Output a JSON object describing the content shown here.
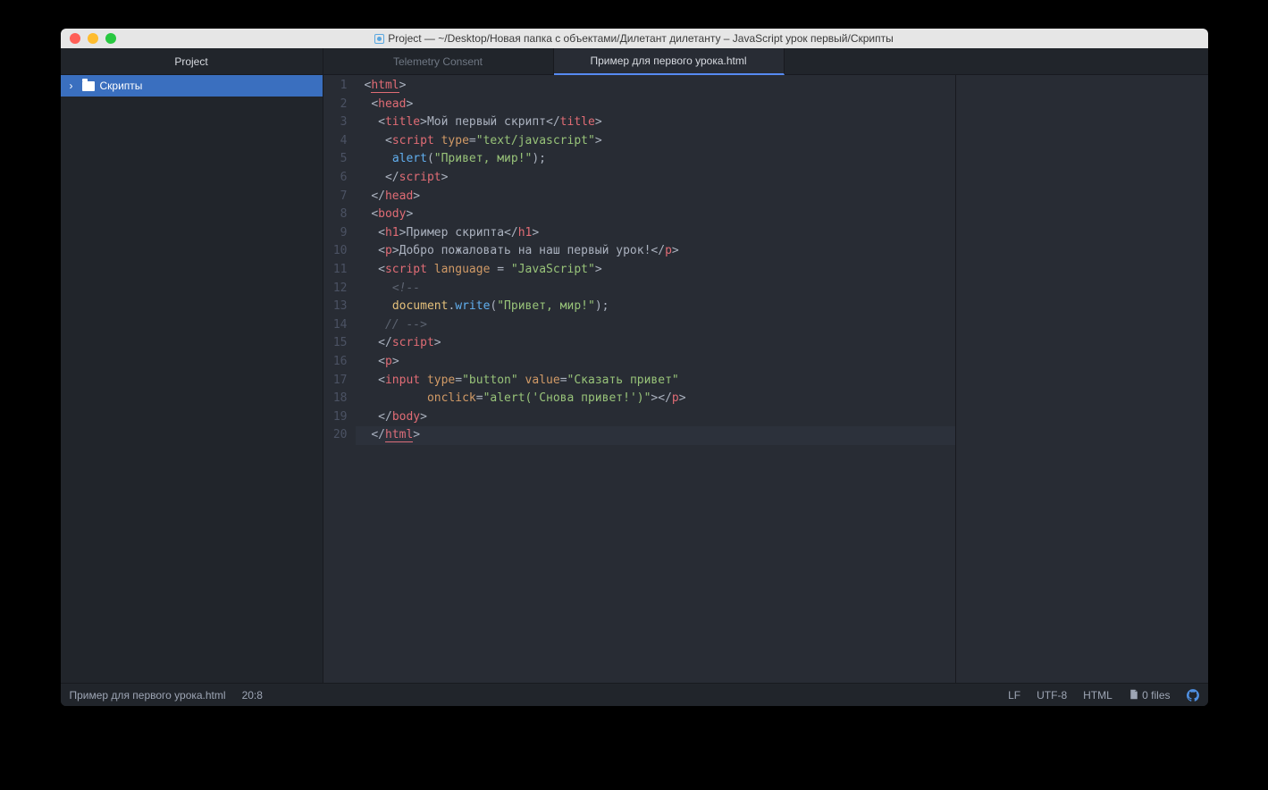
{
  "window": {
    "title": "Project — ~/Desktop/Новая папка с объектами/Дилетант дилетанту – JavaScript урок первый/Скрипты"
  },
  "panes": {
    "project_label": "Project"
  },
  "tabs": [
    {
      "label": "Telemetry Consent",
      "active": false
    },
    {
      "label": "Пример для первого урока.html",
      "active": true
    }
  ],
  "tree": {
    "items": [
      {
        "label": "Скрипты",
        "expanded": true
      }
    ]
  },
  "editor": {
    "cursor_line": 20,
    "line_count": 20,
    "lines": [
      [
        {
          "t": "<",
          "c": "punc"
        },
        {
          "t": "html",
          "c": "tag",
          "u": true
        },
        {
          "t": ">",
          "c": "punc"
        }
      ],
      [
        {
          "t": " ",
          "c": "text"
        },
        {
          "t": "<",
          "c": "punc"
        },
        {
          "t": "head",
          "c": "tag"
        },
        {
          "t": ">",
          "c": "punc"
        }
      ],
      [
        {
          "t": "  ",
          "c": "text"
        },
        {
          "t": "<",
          "c": "punc"
        },
        {
          "t": "title",
          "c": "tag"
        },
        {
          "t": ">",
          "c": "punc"
        },
        {
          "t": "Мой первый скрипт",
          "c": "text"
        },
        {
          "t": "</",
          "c": "punc"
        },
        {
          "t": "title",
          "c": "tag"
        },
        {
          "t": ">",
          "c": "punc"
        }
      ],
      [
        {
          "t": "   ",
          "c": "text"
        },
        {
          "t": "<",
          "c": "punc"
        },
        {
          "t": "script",
          "c": "tag"
        },
        {
          "t": " ",
          "c": "text"
        },
        {
          "t": "type",
          "c": "attr"
        },
        {
          "t": "=",
          "c": "punc"
        },
        {
          "t": "\"text/javascript\"",
          "c": "str"
        },
        {
          "t": ">",
          "c": "punc"
        }
      ],
      [
        {
          "t": "    ",
          "c": "text"
        },
        {
          "t": "alert",
          "c": "fn"
        },
        {
          "t": "(",
          "c": "punc"
        },
        {
          "t": "\"Привет, мир!\"",
          "c": "str"
        },
        {
          "t": ");",
          "c": "punc"
        }
      ],
      [
        {
          "t": "   ",
          "c": "text"
        },
        {
          "t": "</",
          "c": "punc"
        },
        {
          "t": "script",
          "c": "tag"
        },
        {
          "t": ">",
          "c": "punc"
        }
      ],
      [
        {
          "t": " ",
          "c": "text"
        },
        {
          "t": "</",
          "c": "punc"
        },
        {
          "t": "head",
          "c": "tag"
        },
        {
          "t": ">",
          "c": "punc"
        }
      ],
      [
        {
          "t": " ",
          "c": "text"
        },
        {
          "t": "<",
          "c": "punc"
        },
        {
          "t": "body",
          "c": "tag"
        },
        {
          "t": ">",
          "c": "punc"
        }
      ],
      [
        {
          "t": "  ",
          "c": "text"
        },
        {
          "t": "<",
          "c": "punc"
        },
        {
          "t": "h1",
          "c": "tag"
        },
        {
          "t": ">",
          "c": "punc"
        },
        {
          "t": "Пример скрипта",
          "c": "text"
        },
        {
          "t": "</",
          "c": "punc"
        },
        {
          "t": "h1",
          "c": "tag"
        },
        {
          "t": ">",
          "c": "punc"
        }
      ],
      [
        {
          "t": "  ",
          "c": "text"
        },
        {
          "t": "<",
          "c": "punc"
        },
        {
          "t": "p",
          "c": "tag"
        },
        {
          "t": ">",
          "c": "punc"
        },
        {
          "t": "Добро пожаловать на наш первый урок!",
          "c": "text"
        },
        {
          "t": "</",
          "c": "punc"
        },
        {
          "t": "p",
          "c": "tag"
        },
        {
          "t": ">",
          "c": "punc"
        }
      ],
      [
        {
          "t": "  ",
          "c": "text"
        },
        {
          "t": "<",
          "c": "punc"
        },
        {
          "t": "script",
          "c": "tag"
        },
        {
          "t": " ",
          "c": "text"
        },
        {
          "t": "language",
          "c": "attr"
        },
        {
          "t": " ",
          "c": "text"
        },
        {
          "t": "=",
          "c": "punc"
        },
        {
          "t": " ",
          "c": "text"
        },
        {
          "t": "\"JavaScript\"",
          "c": "str"
        },
        {
          "t": ">",
          "c": "punc"
        }
      ],
      [
        {
          "t": "    ",
          "c": "text"
        },
        {
          "t": "<!--",
          "c": "cmt"
        }
      ],
      [
        {
          "t": "    ",
          "c": "text"
        },
        {
          "t": "document",
          "c": "var"
        },
        {
          "t": ".",
          "c": "punc"
        },
        {
          "t": "write",
          "c": "fn"
        },
        {
          "t": "(",
          "c": "punc"
        },
        {
          "t": "\"Привет, мир!\"",
          "c": "str"
        },
        {
          "t": ");",
          "c": "punc"
        }
      ],
      [
        {
          "t": "   ",
          "c": "text"
        },
        {
          "t": "// -->",
          "c": "cmt"
        }
      ],
      [
        {
          "t": "  ",
          "c": "text"
        },
        {
          "t": "</",
          "c": "punc"
        },
        {
          "t": "script",
          "c": "tag"
        },
        {
          "t": ">",
          "c": "punc"
        }
      ],
      [
        {
          "t": "  ",
          "c": "text"
        },
        {
          "t": "<",
          "c": "punc"
        },
        {
          "t": "p",
          "c": "tag"
        },
        {
          "t": ">",
          "c": "punc"
        }
      ],
      [
        {
          "t": "  ",
          "c": "text"
        },
        {
          "t": "<",
          "c": "punc"
        },
        {
          "t": "input",
          "c": "tag"
        },
        {
          "t": " ",
          "c": "text"
        },
        {
          "t": "type",
          "c": "attr"
        },
        {
          "t": "=",
          "c": "punc"
        },
        {
          "t": "\"button\"",
          "c": "str"
        },
        {
          "t": " ",
          "c": "text"
        },
        {
          "t": "value",
          "c": "attr"
        },
        {
          "t": "=",
          "c": "punc"
        },
        {
          "t": "\"Сказать привет\"",
          "c": "str"
        }
      ],
      [
        {
          "t": "         ",
          "c": "text"
        },
        {
          "t": "onclick",
          "c": "attr"
        },
        {
          "t": "=",
          "c": "punc"
        },
        {
          "t": "\"alert('Снова привет!')\"",
          "c": "str"
        },
        {
          "t": "></",
          "c": "punc"
        },
        {
          "t": "p",
          "c": "tag"
        },
        {
          "t": ">",
          "c": "punc"
        }
      ],
      [
        {
          "t": "  ",
          "c": "text"
        },
        {
          "t": "</",
          "c": "punc"
        },
        {
          "t": "body",
          "c": "tag"
        },
        {
          "t": ">",
          "c": "punc"
        }
      ],
      [
        {
          "t": " ",
          "c": "text"
        },
        {
          "t": "</",
          "c": "punc"
        },
        {
          "t": "html",
          "c": "tag",
          "u": true
        },
        {
          "t": ">",
          "c": "punc"
        }
      ]
    ]
  },
  "status": {
    "file": "Пример для первого урока.html",
    "cursor": "20:8",
    "eol": "LF",
    "encoding": "UTF-8",
    "grammar": "HTML",
    "git_files": "0 files"
  }
}
